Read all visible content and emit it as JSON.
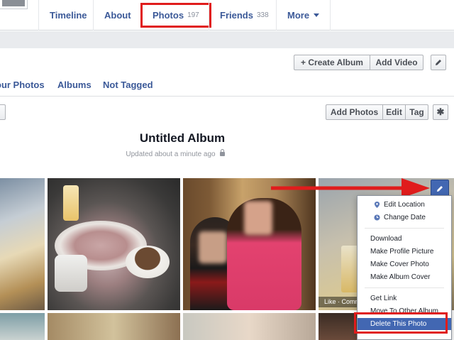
{
  "tabs": {
    "timeline": "Timeline",
    "about": "About",
    "photos": "Photos",
    "photos_count": "197",
    "friends": "Friends",
    "friends_count": "338",
    "more": "More"
  },
  "header": {
    "create_album": "+ Create Album",
    "add_video": "Add Video",
    "subtabs": {
      "your_photos": "our Photos",
      "albums": "Albums",
      "not_tagged": "Not Tagged"
    }
  },
  "album": {
    "title": "Untitled Album",
    "updated": "Updated about a minute ago",
    "add_photos": "Add Photos",
    "edit": "Edit",
    "tag": "Tag"
  },
  "photo_overlay": {
    "like_strip": "Like · Comm"
  },
  "menu": {
    "edit_location": "Edit Location",
    "change_date": "Change Date",
    "download": "Download",
    "make_profile_picture": "Make Profile Picture",
    "make_cover_photo": "Make Cover Photo",
    "make_album_cover": "Make Album Cover",
    "get_link": "Get Link",
    "move_to_other_album": "Move To Other Album",
    "delete_this_photo": "Delete This Photo"
  },
  "colors": {
    "link_blue": "#3b5998",
    "highlight_red": "#e01c1c",
    "menu_selected": "#4267b2"
  }
}
